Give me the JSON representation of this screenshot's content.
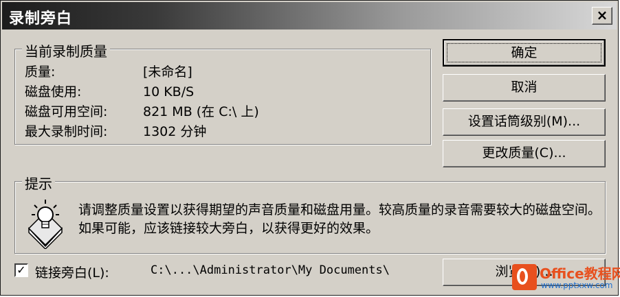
{
  "window": {
    "title": "录制旁白",
    "close_label": "×"
  },
  "quality": {
    "group_title": "当前录制质量",
    "rows": [
      {
        "label": "质量:",
        "value": "[未命名]"
      },
      {
        "label": "磁盘使用:",
        "value": "10 KB/S"
      },
      {
        "label": "磁盘可用空间:",
        "value": "821 MB (在 C:\\ 上)"
      },
      {
        "label": "最大录制时间:",
        "value": "1302 分钟"
      }
    ]
  },
  "buttons": {
    "ok": "确定",
    "cancel": "取消",
    "mic_level": "设置话筒级别(M)...",
    "change_quality": "更改质量(C)...",
    "browse": "浏览(B)..."
  },
  "hint": {
    "group_title": "提示",
    "icon": "lightbulb-icon",
    "text": "请调整质量设置以获得期望的声音质量和磁盘用量。较高质量的录音需要较大的磁盘空间。如果可能，应该链接较大旁白，以获得更好的效果。"
  },
  "link": {
    "checked": true,
    "check_mark": "✓",
    "label": "链接旁白(L):",
    "path": "C:\\...\\Administrator\\My Documents\\"
  },
  "watermark": {
    "title": "Office教程网",
    "url": "www.pptxxw.com"
  },
  "colors": {
    "dialog_face": "#d4d0c8",
    "title_dark": "#1c1c1c",
    "title_light": "#d8d8d8",
    "watermark_orange": "#e8501e",
    "watermark_blue": "#1e6fd0"
  }
}
